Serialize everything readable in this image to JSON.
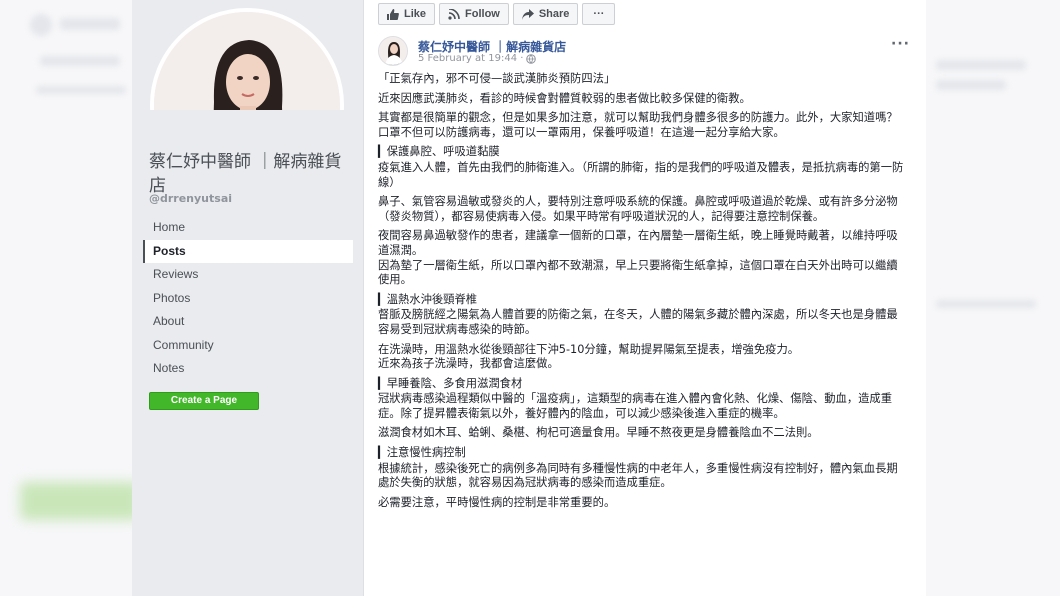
{
  "toolbar": {
    "like_label": "Like",
    "follow_label": "Follow",
    "share_label": "Share",
    "more_label": "···"
  },
  "page": {
    "name": "蔡仁妤中醫師 ｜解病雜貨店",
    "handle": "@drrenyutsai",
    "create_page_label": "Create a Page"
  },
  "sidebar": {
    "items": [
      {
        "label": "Home"
      },
      {
        "label": "Posts"
      },
      {
        "label": "Reviews"
      },
      {
        "label": "Photos"
      },
      {
        "label": "About"
      },
      {
        "label": "Community"
      },
      {
        "label": "Notes"
      }
    ],
    "active_index": 1
  },
  "post": {
    "author": "蔡仁妤中醫師 ｜解病雜貨店",
    "timestamp": "5 February at 19:44 ·",
    "more_label": "···",
    "paragraphs": [
      "「正氣存內，邪不可侵—談武漢肺炎預防四法」",
      "近來因應武漢肺炎，看診的時候會對體質較弱的患者做比較多保健的衛教。",
      "其實都是很簡單的觀念，但是如果多加注意，就可以幫助我們身體多很多的防護力。此外，大家知道嗎？口罩不但可以防護病毒，還可以一罩兩用，保養呼吸道！在這邊一起分享給大家。"
    ],
    "sections": [
      {
        "heading": "▎保護鼻腔、呼吸道黏膜",
        "paragraphs": [
          "疫氣進入人體，首先由我們的肺衛進入。（所謂的肺衛，指的是我們的呼吸道及體表，是抵抗病毒的第一防線）",
          "鼻子、氣管容易過敏或發炎的人，要特別注意呼吸系統的保護。鼻腔或呼吸道過於乾燥、或有許多分泌物（發炎物質），都容易使病毒入侵。如果平時常有呼吸道狀況的人，記得要注意控制保養。",
          "夜間容易鼻過敏發作的患者，建議拿一個新的口罩，在內層墊一層衛生紙，晚上睡覺時戴著，以維持呼吸道濕潤。\n因為墊了一層衛生紙，所以口罩內都不致潮濕，早上只要將衛生紙拿掉，這個口罩在白天外出時可以繼續使用。"
        ]
      },
      {
        "heading": "▎溫熱水沖後頸脊椎",
        "paragraphs": [
          "督脈及膀胱經之陽氣為人體首要的防衛之氣，在冬天，人體的陽氣多藏於體內深處，所以冬天也是身體最容易受到冠狀病毒感染的時節。",
          "在洗澡時，用溫熱水從後頸部往下沖5-10分鐘，幫助提昇陽氣至提表，增強免疫力。\n近來為孩子洗澡時，我都會這麼做。"
        ]
      },
      {
        "heading": "▎早睡養陰、多食用滋潤食材",
        "paragraphs": [
          "冠狀病毒感染過程類似中醫的「溫疫病」，這類型的病毒在進入體內會化熱、化燥、傷陰、動血，造成重症。除了提昇體表衛氣以外，養好體內的陰血，可以減少感染後進入重症的機率。",
          "滋潤食材如木耳、蛤蜊、桑椹、枸杞可適量食用。早睡不熬夜更是身體養陰血不二法則。"
        ]
      },
      {
        "heading": "▎注意慢性病控制",
        "paragraphs": [
          "根據統計，感染後死亡的病例多為同時有多種慢性病的中老年人，多重慢性病沒有控制好，體內氣血長期處於失衡的狀態，就容易因為冠狀病毒的感染而造成重症。",
          "必需要注意，平時慢性病的控制是非常重要的。"
        ]
      }
    ]
  },
  "colors": {
    "link": "#365899",
    "create_button": "#42b72a",
    "sidebar_bg": "#e9ebee"
  }
}
